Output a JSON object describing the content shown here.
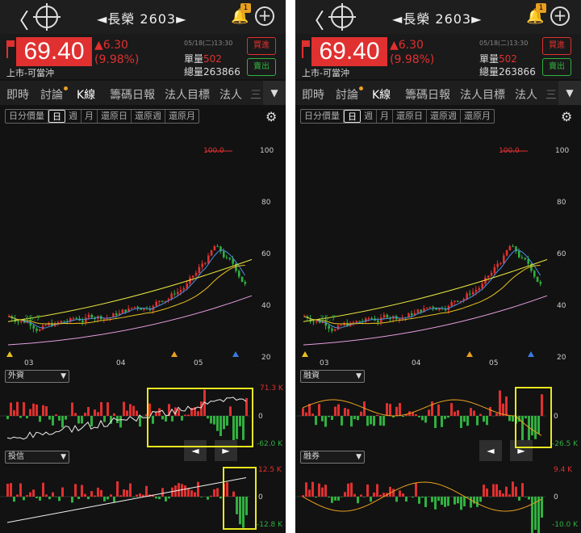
{
  "header": {
    "back": "〈",
    "title": "◄長榮 2603►",
    "bell_badge": "1",
    "plus": "+"
  },
  "quote": {
    "price": "69.40",
    "change": "▲6.30",
    "pct": "(9.98%)",
    "market": "上市-可當沖",
    "time": "05/18(二)13:30",
    "vol_label": "單量",
    "vol": "502",
    "total_label": "總量",
    "total": "263866",
    "buy": "買進",
    "sell": "賣出"
  },
  "tabs": [
    "即時",
    "討論",
    "K線",
    "籌碼日報",
    "法人目標",
    "法人",
    "三"
  ],
  "periods": [
    "日分價量",
    "日",
    "週",
    "月",
    "還原日",
    "還原週",
    "還原月"
  ],
  "main_chart": {
    "y_ticks": [
      "100",
      "80",
      "60",
      "40",
      "20"
    ],
    "x_ticks": [
      "03",
      "04",
      "05"
    ],
    "max_label": "100.0",
    "min_label": "35.7"
  },
  "panels": [
    {
      "ind1": {
        "name": "外資",
        "max": "71.3 K",
        "zero": "0",
        "min": "-62.0 K"
      },
      "ind2": {
        "name": "投信",
        "max": "12.5 K",
        "zero": "0",
        "min": "-12.8 K"
      }
    },
    {
      "ind1": {
        "name": "融資",
        "max": "",
        "zero": "0",
        "min": "-26.5 K"
      },
      "ind2": {
        "name": "融券",
        "max": "9.4 K",
        "zero": "0",
        "min": "-10.0 K"
      }
    }
  ],
  "nav": {
    "prev": "◄",
    "next": "►"
  },
  "colors": {
    "up": "#e03030",
    "down": "#30b040",
    "accent": "#e8e820"
  },
  "chart_data": {
    "type": "candlestick",
    "y_range": [
      20,
      100
    ],
    "x_ticks": [
      "03",
      "04",
      "05"
    ],
    "max_label": "100.0",
    "min_label": "35.7"
  }
}
